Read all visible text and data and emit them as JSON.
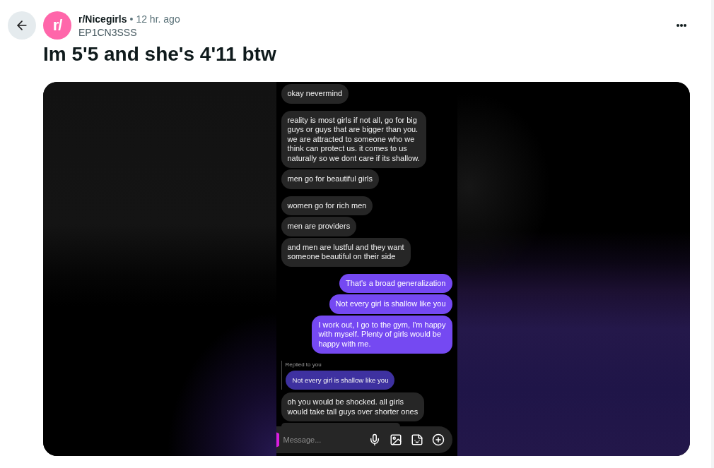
{
  "post": {
    "avatar_text": "r/",
    "subreddit": "r/Nicegirls",
    "separator": "•",
    "time": "12 hr. ago",
    "author": "EP1CN3SSS",
    "title": "Im 5'5 and she's 4'11 btw"
  },
  "chat_screenshot": {
    "groups": [
      {
        "kind": "received",
        "messages": [
          {
            "text": "okay nevermind"
          }
        ]
      },
      {
        "kind": "received",
        "messages": [
          {
            "text": "reality is most girls if not all, go for big\nguys or guys that are bigger than you.\nwe are attracted to someone who we\nthink can protect us. it comes to us\nnaturally so we dont care if its shallow."
          },
          {
            "text": "men go for beautiful girls"
          }
        ]
      },
      {
        "kind": "received",
        "messages": [
          {
            "text": "women go for rich men"
          },
          {
            "text": "men are providers"
          },
          {
            "text": "and men are lustful and they want\nsomeone beautiful on their side"
          }
        ]
      },
      {
        "kind": "sent",
        "messages": [
          {
            "text": "That's a broad generalization"
          },
          {
            "text": "Not every girl is shallow like you"
          },
          {
            "text": "I work out, I go to the gym, I'm happy\nwith myself. Plenty of girls would be\nhappy with me."
          }
        ]
      },
      {
        "kind": "received",
        "messages": [
          {
            "reply_to": {
              "label": "Replied to you",
              "text": "Not every girl is shallow like you"
            },
            "text": "oh you would be shocked. all girls\nwould take tall guys over shorter ones"
          }
        ]
      }
    ],
    "composer": {
      "placeholder": "Message..."
    }
  }
}
